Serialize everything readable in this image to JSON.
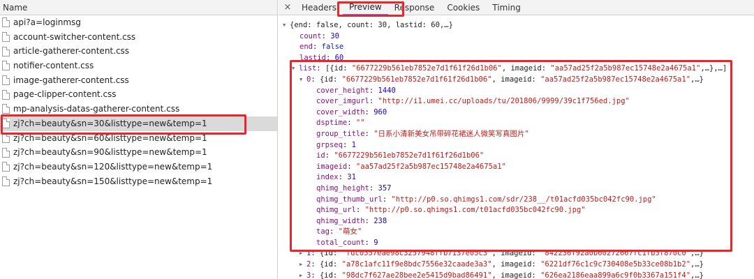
{
  "left_panel": {
    "header": "Name",
    "requests": [
      "api?a=loginmsg",
      "account-switcher-content.css",
      "article-gatherer-content.css",
      "notifier-content.css",
      "image-gatherer-content.css",
      "page-clipper-content.css",
      "mp-analysis-datas-gatherer-content.css",
      "zj?ch=beauty&sn=30&listtype=new&temp=1",
      "zj?ch=beauty&sn=60&listtype=new&temp=1",
      "zj?ch=beauty&sn=90&listtype=new&temp=1",
      "zj?ch=beauty&sn=120&listtype=new&temp=1",
      "zj?ch=beauty&sn=150&listtype=new&temp=1"
    ],
    "selected_index": 7
  },
  "tabs": {
    "close": "×",
    "items": [
      "Headers",
      "Preview",
      "Response",
      "Cookies",
      "Timing"
    ],
    "active": "Preview"
  },
  "preview": {
    "root_summary": "{end: false, count: 30, lastid: 60,…}",
    "root_fields": [
      {
        "key": "count",
        "value": "30",
        "type": "number"
      },
      {
        "key": "end",
        "value": "false",
        "type": "bool"
      },
      {
        "key": "lastid",
        "value": "60",
        "type": "number"
      }
    ],
    "list_key": "list",
    "list_summary_prefix": "[{id: ",
    "list_summary_id": "\"6677229b561eb7852e7d1f61f26d1b06\"",
    "list_summary_mid": ", imageid: ",
    "list_summary_imageid": "\"aa57ad25f2a5b987ec15748e2a4675a1\"",
    "list_summary_suffix": ",…},…]",
    "item0_key": "0",
    "item0_summary_prefix": "{id: ",
    "item0_summary_id": "\"6677229b561eb7852e7d1f61f26d1b06\"",
    "item0_summary_mid": ", imageid: ",
    "item0_summary_imageid": "\"aa57ad25f2a5b987ec15748e2a4675a1\"",
    "item0_summary_suffix": ",…}",
    "item0_fields": [
      {
        "key": "cover_height",
        "value": "1440",
        "type": "number"
      },
      {
        "key": "cover_imgurl",
        "value": "\"http://i1.umei.cc/uploads/tu/201806/9999/39c1f756ed.jpg\"",
        "type": "string"
      },
      {
        "key": "cover_width",
        "value": "960",
        "type": "number"
      },
      {
        "key": "dsptime",
        "value": "\"\"",
        "type": "string"
      },
      {
        "key": "group_title",
        "value": "\"日系小清新美女吊带碎花裙迷人微笑写真图片\"",
        "type": "string"
      },
      {
        "key": "grpseq",
        "value": "1",
        "type": "number"
      },
      {
        "key": "id",
        "value": "\"6677229b561eb7852e7d1f61f26d1b06\"",
        "type": "string"
      },
      {
        "key": "imageid",
        "value": "\"aa57ad25f2a5b987ec15748e2a4675a1\"",
        "type": "string"
      },
      {
        "key": "index",
        "value": "31",
        "type": "number"
      },
      {
        "key": "qhimg_height",
        "value": "357",
        "type": "number"
      },
      {
        "key": "qhimg_thumb_url",
        "value": "\"http://p0.so.qhimgs1.com/sdr/238__/t01acfd035bc042fc90.jpg\"",
        "type": "string"
      },
      {
        "key": "qhimg_url",
        "value": "\"http://p0.so.qhimgs1.com/t01acfd035bc042fc90.jpg\"",
        "type": "string"
      },
      {
        "key": "qhimg_width",
        "value": "238",
        "type": "number"
      },
      {
        "key": "tag",
        "value": "\"萌女\"",
        "type": "string"
      },
      {
        "key": "total_count",
        "value": "9",
        "type": "number"
      }
    ],
    "collapsed_items": [
      {
        "key": "1",
        "id": "\"fdc0557eae98c3257948ffb7137e05c3\"",
        "imageid": "\"842236f92a0b60272667fc1fb5f870c0\""
      },
      {
        "key": "2",
        "id": "\"a78c1afc11f9e8bdc7556e32caade3a3\"",
        "imageid": "\"6221df76c1c9c730408e5b33ce08b1b2\""
      },
      {
        "key": "3",
        "id": "\"98dc7f627ae28bee2e5415d9bad86491\"",
        "imageid": "\"626ea2186eaa899a6c9f0b3367a151f4\""
      }
    ]
  },
  "colors": {
    "highlight": "#e8262c",
    "key": "#881280",
    "string": "#c41a16",
    "number": "#1c00cf",
    "selected_row": "#dadada"
  }
}
